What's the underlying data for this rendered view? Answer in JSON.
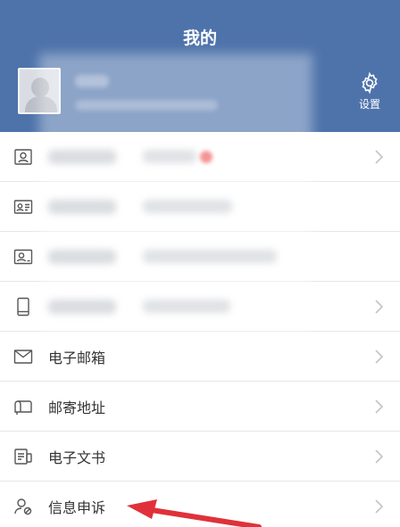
{
  "header": {
    "title": "我的",
    "settings_label": "设置"
  },
  "menu": [
    {
      "label": "电子邮箱"
    },
    {
      "label": "邮寄地址"
    },
    {
      "label": "电子文书"
    },
    {
      "label": "信息申诉"
    }
  ],
  "colors": {
    "header_bg": "#4e73ab",
    "annotation_arrow": "#e0313a"
  }
}
